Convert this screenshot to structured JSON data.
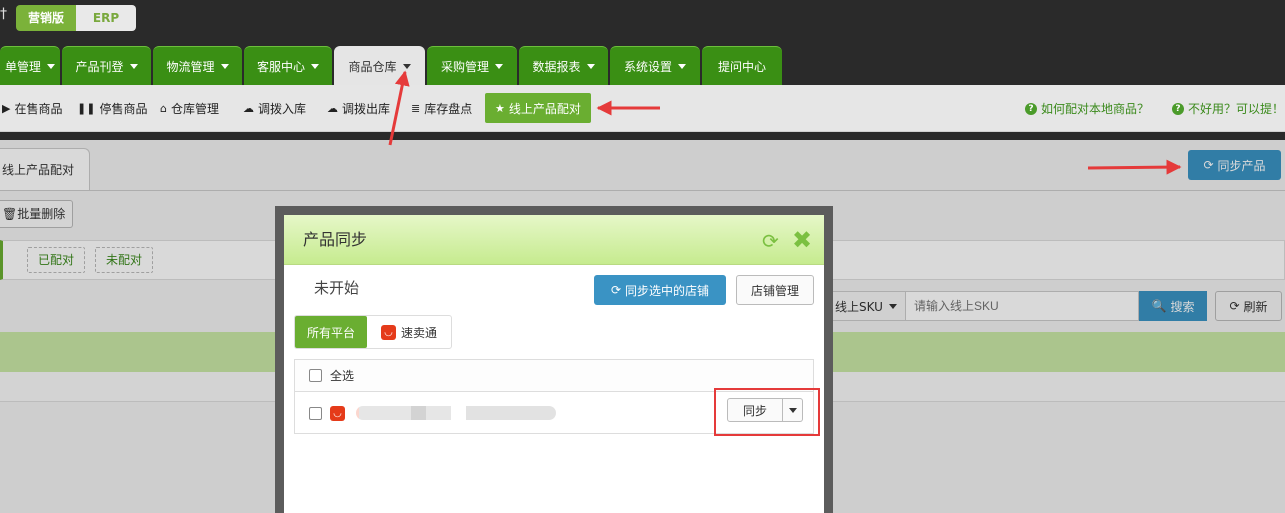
{
  "header": {
    "logo_glyph": "†",
    "edition_marketing": "营销版",
    "edition_erp": "ERP"
  },
  "nav": {
    "tabs": [
      {
        "label": "单管理",
        "caret": true,
        "active": false
      },
      {
        "label": "产品刊登",
        "caret": true,
        "active": false
      },
      {
        "label": "物流管理",
        "caret": true,
        "active": false
      },
      {
        "label": "客服中心",
        "caret": true,
        "active": false
      },
      {
        "label": "商品仓库",
        "caret": true,
        "active": true
      },
      {
        "label": "采购管理",
        "caret": true,
        "active": false
      },
      {
        "label": "数据报表",
        "caret": true,
        "active": false
      },
      {
        "label": "系统设置",
        "caret": true,
        "active": false
      },
      {
        "label": "提问中心",
        "caret": false,
        "active": false
      }
    ]
  },
  "subnav": {
    "items": [
      {
        "icon": "▶",
        "label": "在售商品"
      },
      {
        "icon": "❚❚",
        "label": "停售商品"
      },
      {
        "icon": "⌂",
        "label": "仓库管理"
      },
      {
        "icon": "☁",
        "label": "调拨入库"
      },
      {
        "icon": "☁",
        "label": "调拨出库"
      },
      {
        "icon": "≣",
        "label": "库存盘点"
      },
      {
        "icon": "★",
        "label": "线上产品配对"
      }
    ],
    "help_match": "如何配对本地商品？",
    "help_feedback": "不好用？可以提！"
  },
  "page": {
    "tab_label": "线上产品配对",
    "sync_products": "同步产品",
    "batch_delete": "批量删除",
    "filter_matched": "已配对",
    "filter_unmatched": "未配对",
    "sku_select": "线上SKU",
    "sku_placeholder": "请输入线上SKU",
    "search": "搜索",
    "refresh": "刷新"
  },
  "modal": {
    "title": "产品同步",
    "status": "未开始",
    "sync_selected": "同步选中的店铺",
    "shop_manage": "店铺管理",
    "platform_all": "所有平台",
    "platform_aliexpress": "速卖通",
    "select_all": "全选",
    "row_sync": "同步"
  },
  "colors": {
    "brand_green": "#6aae31",
    "nav_green": "#3a8f14",
    "primary_blue": "#3a93c4",
    "annotation_red": "#e53a3a",
    "aliexpress_red": "#e53b1a"
  }
}
